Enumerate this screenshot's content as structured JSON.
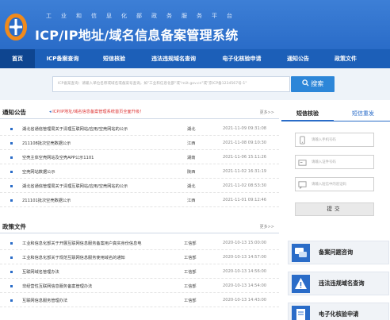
{
  "header": {
    "ministry": "工业和信息化部政务服务平台",
    "title": "ICP/IP地址/域名信息备案管理系统"
  },
  "nav": {
    "items": [
      {
        "label": "首页",
        "active": true
      },
      {
        "label": "ICP备案查询"
      },
      {
        "label": "短信核验"
      },
      {
        "label": "违法违规域名查询"
      },
      {
        "label": "电子化核验申请"
      },
      {
        "label": "通知公告"
      },
      {
        "label": "政策文件"
      }
    ]
  },
  "search": {
    "placeholder": "ICP备案查询：请输入单位名称或域名或备案号查询，如\"工业和信息化部\"或\"miit.gov.cn\"或\"京ICP备1234567号-1\"",
    "button_label": "搜索"
  },
  "notices": {
    "title": "通知公告",
    "scroll_note": "ICP/IP地址/域名信息备案管理系统首页全面升级！",
    "more": "更多>>",
    "rows": [
      {
        "text": "湖北省通信管理局关于清理互联网站/应用/空壳网站的公示",
        "region": "湖北",
        "date": "2021-11-09 09:31:08"
      },
      {
        "text": "211108批次空壳数据公示",
        "region": "江西",
        "date": "2021-11-08 09:10:30"
      },
      {
        "text": "空壳主体空壳网站及空壳APP公示1101",
        "region": "湖南",
        "date": "2021-11-06 15:11:26"
      },
      {
        "text": "空壳网站数据公示",
        "region": "陕西",
        "date": "2021-11-02 16:31:19"
      },
      {
        "text": "湖北省通信管理局关于清理互联网站/应用/空壳网站的公示",
        "region": "湖北",
        "date": "2021-11-02 08:53:30"
      },
      {
        "text": "211101批次空壳数据公示",
        "region": "江西",
        "date": "2021-11-01 09:12:46"
      }
    ]
  },
  "policies": {
    "title": "政策文件",
    "more": "更多>>",
    "rows": [
      {
        "text": "工业和信息化部关于开展互联网信息服务备案用户真实身份信息电",
        "dept": "工信部",
        "date": "2020-10-13 15:00:00"
      },
      {
        "text": "工业和信息化部关于规范互联网信息服务使用域名的通知",
        "dept": "工信部",
        "date": "2020-10-13 14:57:00"
      },
      {
        "text": "互联网域名管理办法",
        "dept": "工信部",
        "date": "2020-10-13 14:56:00"
      },
      {
        "text": "非经营性互联网信息服务备案管理办法",
        "dept": "工信部",
        "date": "2020-10-13 14:54:00"
      },
      {
        "text": "互联网信息服务管理办法",
        "dept": "工信部",
        "date": "2020-10-13 14:43:00"
      }
    ]
  },
  "sms": {
    "tab_verify": "短信核验",
    "tab_resend": "短信重发",
    "phone_placeholder": "请输入手机号码",
    "id_placeholder": "请输入证件号码",
    "code_placeholder": "请输入短信中的验证码",
    "submit_label": "提交"
  },
  "services": [
    {
      "label": "备案问题咨询",
      "icon": "chat-icon"
    },
    {
      "label": "违法违规域名查询",
      "icon": "warning-icon"
    },
    {
      "label": "电子化核验申请",
      "icon": "document-icon"
    }
  ],
  "colors": {
    "header_blue": "#2a6cc8",
    "nav_blue": "#1c5fb8",
    "nav_active": "#0e4590",
    "logo_orange": "#f08a1c"
  }
}
